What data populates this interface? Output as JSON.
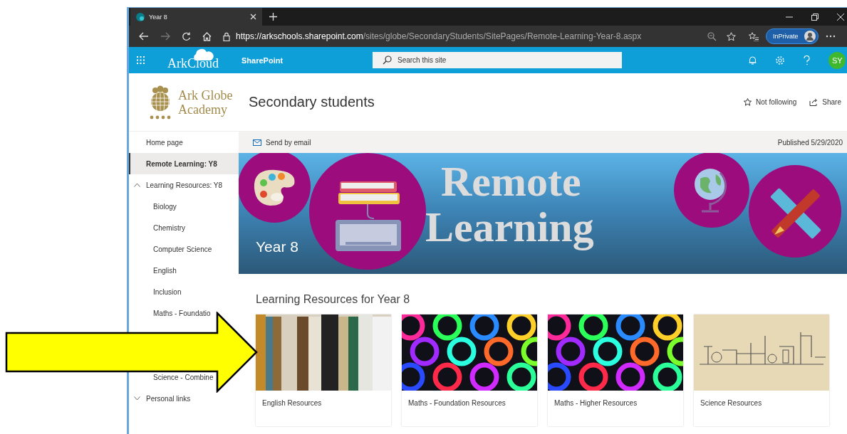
{
  "browser": {
    "tab_title": "Year 8",
    "url_host": "https://arkschools.sharepoint.com",
    "url_path": "/sites/globe/SecondaryStudents/SitePages/Remote-Learning-Year-8.aspx",
    "inprivate_label": "InPrivate"
  },
  "suite_bar": {
    "logo_text": "ArkCloud",
    "app_name": "SharePoint",
    "search": {
      "placeholder": "Search this site"
    },
    "avatar_initials": "SY"
  },
  "site_header": {
    "logo_lines": [
      "Ark Globe",
      "Academy"
    ],
    "site_title": "Secondary students",
    "actions": [
      {
        "kind": "follow",
        "label": "Not following"
      },
      {
        "kind": "share",
        "label": "Share"
      }
    ]
  },
  "nav": [
    {
      "label": "Home page",
      "selected": false
    },
    {
      "label": "Remote Learning: Y8",
      "selected": true
    },
    {
      "label": "Learning Resources: Y8",
      "selected": false,
      "expanded": true,
      "children": [
        {
          "label": "Biology",
          "selected": false
        },
        {
          "label": "Chemistry",
          "selected": false
        },
        {
          "label": "Computer Science",
          "selected": false
        },
        {
          "label": "English",
          "selected": false
        },
        {
          "label": "Inclusion",
          "selected": false
        },
        {
          "label": "Maths - Foundatio",
          "selected": false
        },
        {
          "label": "Science - Combine",
          "selected": false
        }
      ]
    },
    {
      "label": "Personal links",
      "selected": false,
      "expanded": false
    }
  ],
  "command_bar": {
    "action": "Send by email",
    "published": "Published 5/29/2020"
  },
  "banner": {
    "subtitle": "Year 8",
    "heading": [
      "Remote",
      "Learning"
    ]
  },
  "section": {
    "title": "Learning Resources for Year 8",
    "cards": [
      {
        "title": "English Resources",
        "kind": "books"
      },
      {
        "title": "Maths - Foundation Resources",
        "kind": "numbers"
      },
      {
        "title": "Maths - Higher Resources",
        "kind": "numbers"
      },
      {
        "title": "Science Resources",
        "kind": "lab"
      }
    ]
  }
}
